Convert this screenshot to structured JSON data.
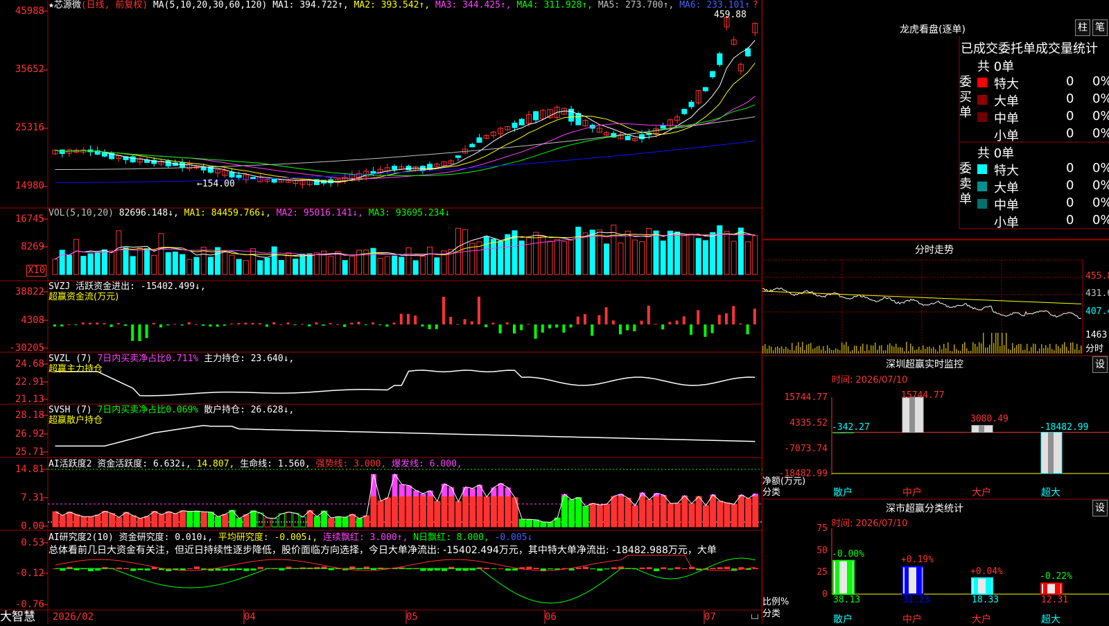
{
  "colors": {
    "up": "#ff3232",
    "down": "#00ffff",
    "grid": "#a00000",
    "ma1": "#ffffff",
    "ma2": "#ffff00",
    "ma3": "#ff40ff",
    "ma4": "#00ff00",
    "ma5": "#c0c0c0",
    "ma6": "#1010ff"
  },
  "main": {
    "star": "★",
    "stock_name": "芯源微",
    "period": "(日线, 前复权)",
    "ma_params": "MA(5,10,20,30,60,120)",
    "ma1": "MA1: 394.722↑,",
    "ma2": "MA2: 393.542↑,",
    "ma3": "MA3: 344.425↑,",
    "ma4": "MA4: 311.928↑,",
    "ma5": "MA5: 273.700↑,",
    "ma6": "MA6: 233.101↑",
    "high_label": "459.88",
    "low_label": "←154.00",
    "y_labels": [
      "45988",
      "35652",
      "25316",
      "14980"
    ],
    "corner_q": "?"
  },
  "vol": {
    "title": "VOL(5,10,20)",
    "value": "82696.148↓,",
    "ma1": "MA1: 84459.766↓,",
    "ma2": "MA2: 95016.141↓,",
    "ma3": "MA3: 93695.234↓",
    "y_labels": [
      "16745",
      "8269"
    ],
    "unit": "X10"
  },
  "svzj": {
    "title": "SVZJ  活跃资金进出: -15402.499↓,",
    "subtitle": "超赢资金流(万元)",
    "y_labels": [
      "38822",
      "4308",
      "-30205"
    ]
  },
  "svzl": {
    "title": "SVZL (7)",
    "ratio": "7日内买卖净占比0.711%",
    "hold": "主力持仓: 23.640↓,",
    "subtitle": "超赢主力持仓",
    "y_labels": [
      "24.68",
      "22.91",
      "21.13"
    ]
  },
  "svsh": {
    "title": "SVSH (7)",
    "ratio": "7日内买卖净占比0.069%",
    "hold": "散户持仓: 26.628↓,",
    "subtitle": "超赢散户持仓",
    "y_labels": [
      "28.18",
      "26.92",
      "25.71"
    ]
  },
  "ai1": {
    "title": "AI活跃度2 资金活跃度: 6.632↓,",
    "v2": "14.807,",
    "v3": "生命线: 1.560,",
    "v4": "强势线: 3.000,",
    "v5": "爆发线: 6.000,",
    "y_labels": [
      "14.81",
      "7.31",
      "0.00"
    ]
  },
  "ai2": {
    "title": "AI研究度2(10) 资金研究度: 0.010↓,",
    "v2": "平均研究度: -0.005↓,",
    "v3": "连续飘红: 3.000↑,",
    "v4": "N日飘红: 8.000,",
    "v5": "-0.005↓",
    "summary": "总体看前几日大资金有关注，但近日持续性逐步降低，股价面临方向选择，今日大单净流出: -15402.494万元，其中特大单净流出: -18482.988万元，大单",
    "y_labels": [
      "0.53",
      "-0.12",
      "-0.76"
    ]
  },
  "x_axis": {
    "labels": [
      "2026/02",
      "04",
      "05",
      "06",
      "07"
    ],
    "brand": "大智慧"
  },
  "lhb": {
    "title": "龙虎看盘(逐单)",
    "btn1": "柱",
    "btn2": "笔",
    "header": "已成交委托单成交量统计",
    "buy_group": "委买单",
    "sell_group": "委卖单",
    "buy_total": "共 0单",
    "sell_total": "共 0单",
    "buy_rows": [
      {
        "label": "特大",
        "value": "0",
        "pct": "0%",
        "color": "#ff0000"
      },
      {
        "label": "大单",
        "value": "0",
        "pct": "0%",
        "color": "#900000"
      },
      {
        "label": "中单",
        "value": "0",
        "pct": "0%",
        "color": "#700000"
      },
      {
        "label": "小单",
        "value": "0",
        "pct": "0%",
        "color": ""
      }
    ],
    "sell_rows": [
      {
        "label": "特大",
        "value": "0",
        "pct": "0%",
        "color": "#00ffff"
      },
      {
        "label": "大单",
        "value": "0",
        "pct": "0%",
        "color": "#009090"
      },
      {
        "label": "中单",
        "value": "0",
        "pct": "0%",
        "color": "#007070"
      },
      {
        "label": "小单",
        "value": "0",
        "pct": "0%",
        "color": ""
      }
    ]
  },
  "intraday": {
    "title": "分时走势",
    "y_labels": [
      "455.8",
      "431.6",
      "407.4",
      "1463"
    ],
    "fen_shi": "分时"
  },
  "sz_monitor": {
    "title": "深圳超赢实时监控",
    "btn": "设",
    "time": "时间: 2026/07/10",
    "y_labels": [
      "15744.77",
      "4335.52",
      "-7073.74",
      "-18482.99"
    ],
    "ylabel1": "净额(万元)",
    "ylabel2": "分类",
    "categories": [
      "散户",
      "中户",
      "大户",
      "超大"
    ],
    "values": [
      -342.27,
      15744.77,
      3080.49,
      -18482.99
    ],
    "value_labels": [
      "-342.27",
      "15744.77",
      "3080.49",
      "-18482.99"
    ]
  },
  "sz_class": {
    "title": "深市超赢分类统计",
    "btn": "设",
    "time": "时间: 2026/07/10",
    "y_labels": [
      "75",
      "50",
      "25",
      "0"
    ],
    "ylabel1": "比例%",
    "ylabel2": "分类",
    "categories": [
      "散户",
      "中户",
      "大户",
      "超大"
    ],
    "values": [
      38.13,
      31.23,
      18.33,
      12.31
    ],
    "value_labels": [
      "38.13",
      "31.23",
      "18.33",
      "12.31"
    ],
    "changes": [
      "-0.00%",
      "+0.19%",
      "+0.04%",
      "-0.22%"
    ]
  }
}
